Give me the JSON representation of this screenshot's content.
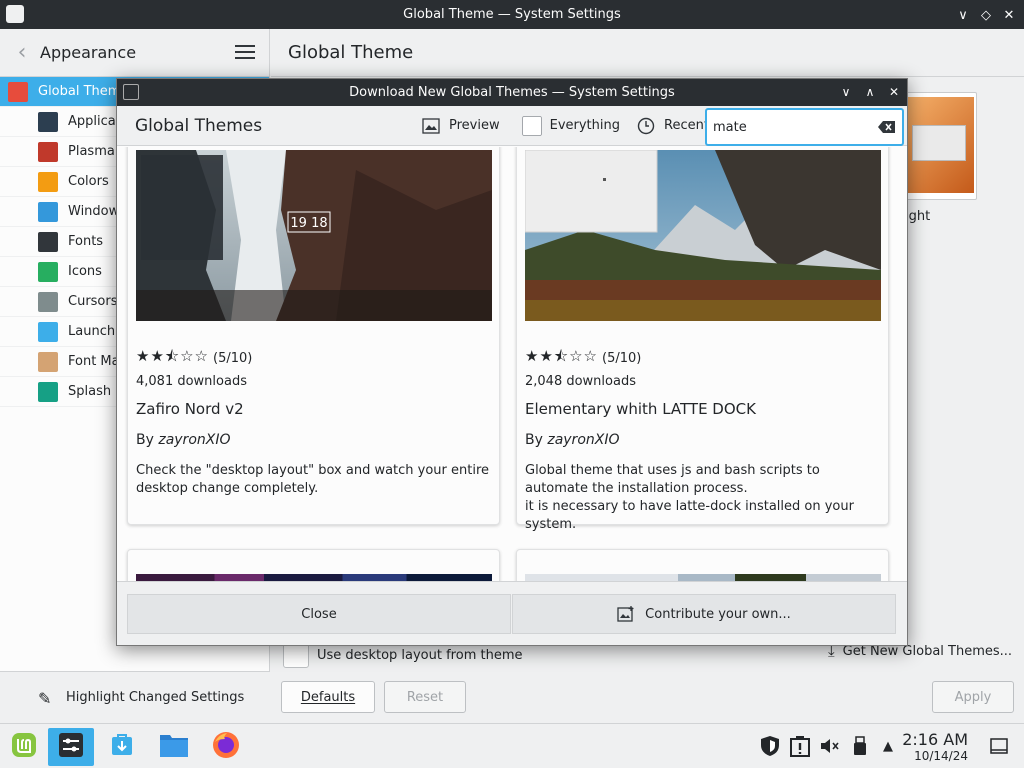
{
  "window": {
    "title": "Global Theme — System Settings"
  },
  "sidebar": {
    "header": "Appearance",
    "items": [
      {
        "label": "Global Theme",
        "icon": "global-theme-icon",
        "color": "#e74c3c"
      },
      {
        "label": "Application Style",
        "icon": "application-style-icon",
        "color": "#2c3e50"
      },
      {
        "label": "Plasma Style",
        "icon": "plasma-style-icon",
        "color": "#c0392b"
      },
      {
        "label": "Colors",
        "icon": "colors-icon",
        "color": "#f39c12"
      },
      {
        "label": "Window Decorations",
        "icon": "window-decorations-icon",
        "color": "#3498db"
      },
      {
        "label": "Fonts",
        "icon": "fonts-icon",
        "color": "#31363b"
      },
      {
        "label": "Icons",
        "icon": "icons-icon",
        "color": "#27ae60"
      },
      {
        "label": "Cursors",
        "icon": "cursors-icon",
        "color": "#7f8c8d"
      },
      {
        "label": "Launch Feedback",
        "icon": "launch-feedback-icon",
        "color": "#3daee9"
      },
      {
        "label": "Font Management",
        "icon": "font-management-icon",
        "color": "#d4a373"
      },
      {
        "label": "Splash Screen",
        "icon": "splash-screen-icon",
        "color": "#16a085"
      }
    ],
    "footer": "Highlight Changed Settings"
  },
  "main": {
    "title": "Global Theme",
    "thumb_label": "ight",
    "use_desktop_layout": "Use desktop layout from theme",
    "get_new": "Get New Global Themes...",
    "defaults": "Defaults",
    "reset": "Reset",
    "apply": "Apply"
  },
  "dialog": {
    "title": "Download New Global Themes — System Settings",
    "heading": "Global Themes",
    "preview": "Preview",
    "everything": "Everything",
    "recent": "Recent",
    "search_value": "mate",
    "cards": [
      {
        "rating": 5,
        "rating_text": "(5/10)",
        "downloads": "4,081 downloads",
        "name": "Zafiro Nord v2",
        "by": "By ",
        "author": "zayronXIO",
        "description": "Check the \"desktop layout\" box and watch your entire desktop change completely.",
        "clock": "19 18"
      },
      {
        "rating": 5,
        "rating_text": "(5/10)",
        "downloads": "2,048 downloads",
        "name": "Elementary whith LATTE DOCK",
        "by": "By ",
        "author": "zayronXIO",
        "description": "Global theme that uses js and bash scripts to automate the installation process.\nit is necessary to have latte-dock installed on your system."
      }
    ],
    "close": "Close",
    "contribute": "Contribute your own..."
  },
  "taskbar": {
    "time": "2:16 AM",
    "date": "10/14/24"
  }
}
